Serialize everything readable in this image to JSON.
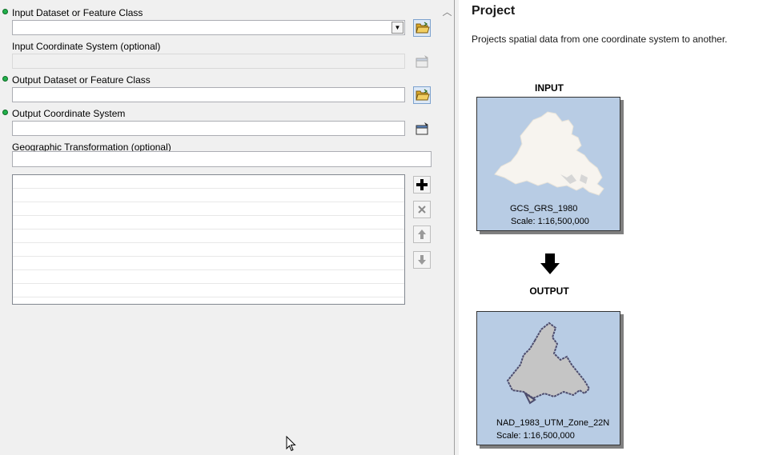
{
  "params": {
    "input_dataset": {
      "label": "Input Dataset or Feature Class",
      "value": ""
    },
    "input_crs": {
      "label": "Input Coordinate System (optional)",
      "value": ""
    },
    "output_dataset": {
      "label": "Output Dataset or Feature Class",
      "value": ""
    },
    "output_crs": {
      "label": "Output Coordinate System",
      "value": ""
    },
    "geo_transform": {
      "label": "Geographic Transformation (optional)",
      "value": ""
    }
  },
  "icons": {
    "browse": "folder-open-icon",
    "properties": "properties-icon",
    "add": "plus-icon",
    "remove": "x-icon",
    "move_up": "arrow-up-icon",
    "move_down": "arrow-down-icon"
  },
  "colors": {
    "required_dot": "#22b14c",
    "map_background": "#b8cce4"
  },
  "help": {
    "title": "Project",
    "description": "Projects spatial data from one coordinate system to another.",
    "input_caption": "INPUT",
    "output_caption": "OUTPUT",
    "input_map": {
      "crs": "GCS_GRS_1980",
      "scale": "Scale: 1:16,500,000"
    },
    "output_map": {
      "crs": "NAD_1983_UTM_Zone_22N",
      "scale": "Scale: 1:16,500,000"
    }
  }
}
